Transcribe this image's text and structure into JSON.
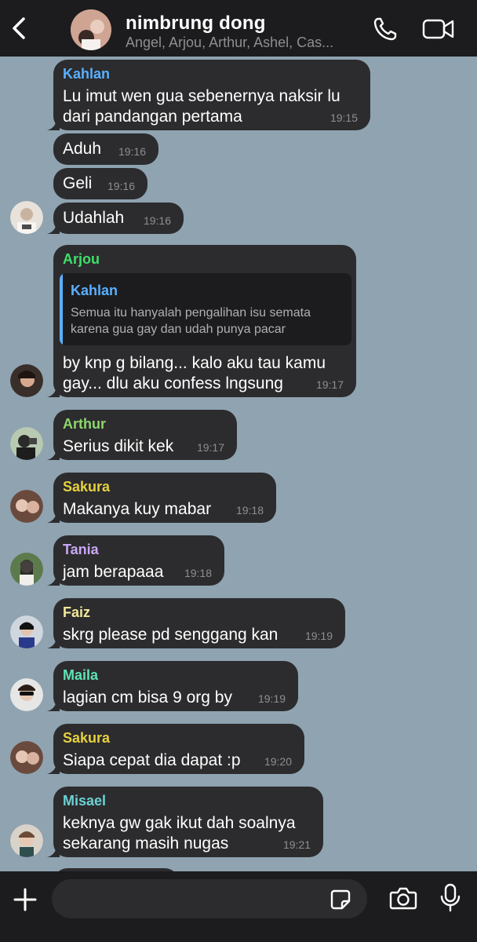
{
  "header": {
    "title": "nimbrung dong",
    "members": "Angel, Arjou, Arthur, Ashel, Cas...",
    "back_icon": "chevron-left-icon",
    "call_icon": "phone-icon",
    "video_icon": "video-camera-icon"
  },
  "colors": {
    "background": "#8fa3b1",
    "bubble": "#2c2c2e",
    "bar": "#1c1c1e",
    "time": "#8e8e93"
  },
  "messages": [
    {
      "sender": "Kahlan",
      "color": "#5ab0ff",
      "lines": [
        "Lu imut wen gua sebenernya naksir lu",
        "dari pandangan pertama"
      ],
      "time": "19:15"
    },
    {
      "lines": [
        "Aduh"
      ],
      "time": "19:16"
    },
    {
      "lines": [
        "Geli"
      ],
      "time": "19:16"
    },
    {
      "lines": [
        "Udahlah"
      ],
      "time": "19:16"
    },
    {
      "sender": "Arjou",
      "color": "#3ee06a",
      "reply": {
        "name": "Kahlan",
        "color": "#5ab0ff",
        "lines": [
          "Semua itu hanyalah pengalihan isu semata",
          "karena gua gay dan udah punya pacar"
        ]
      },
      "lines": [
        "by knp g bilang... kalo aku tau kamu",
        "gay... dlu aku confess lngsung"
      ],
      "time": "19:17"
    },
    {
      "sender": "Arthur",
      "color": "#8ed66b",
      "lines": [
        "Serius dikit kek"
      ],
      "time": "19:17"
    },
    {
      "sender": "Sakura",
      "color": "#e6d13d",
      "lines": [
        "Makanya kuy mabar"
      ],
      "time": "19:18"
    },
    {
      "sender": "Tania",
      "color": "#c9a7f5",
      "lines": [
        "jam berapaaa"
      ],
      "time": "19:18"
    },
    {
      "sender": "Faiz",
      "color": "#f3e79b",
      "lines": [
        "skrg please pd senggang kan"
      ],
      "time": "19:19"
    },
    {
      "sender": "Maila",
      "color": "#5fe3b4",
      "lines": [
        "lagian cm bisa 9 org by"
      ],
      "time": "19:19"
    },
    {
      "sender": "Sakura",
      "color": "#e6d13d",
      "lines": [
        "Siapa cepat dia dapat :p"
      ],
      "time": "19:20"
    },
    {
      "sender": "Misael",
      "color": "#6bd1d4",
      "lines": [
        "keknya gw gak ikut dah soalnya",
        "sekarang masih nugas"
      ],
      "time": "19:21"
    }
  ],
  "composer": {
    "placeholder": "",
    "plus_icon": "plus-icon",
    "sticker_icon": "sticker-icon",
    "camera_icon": "camera-icon",
    "mic_icon": "microphone-icon"
  }
}
